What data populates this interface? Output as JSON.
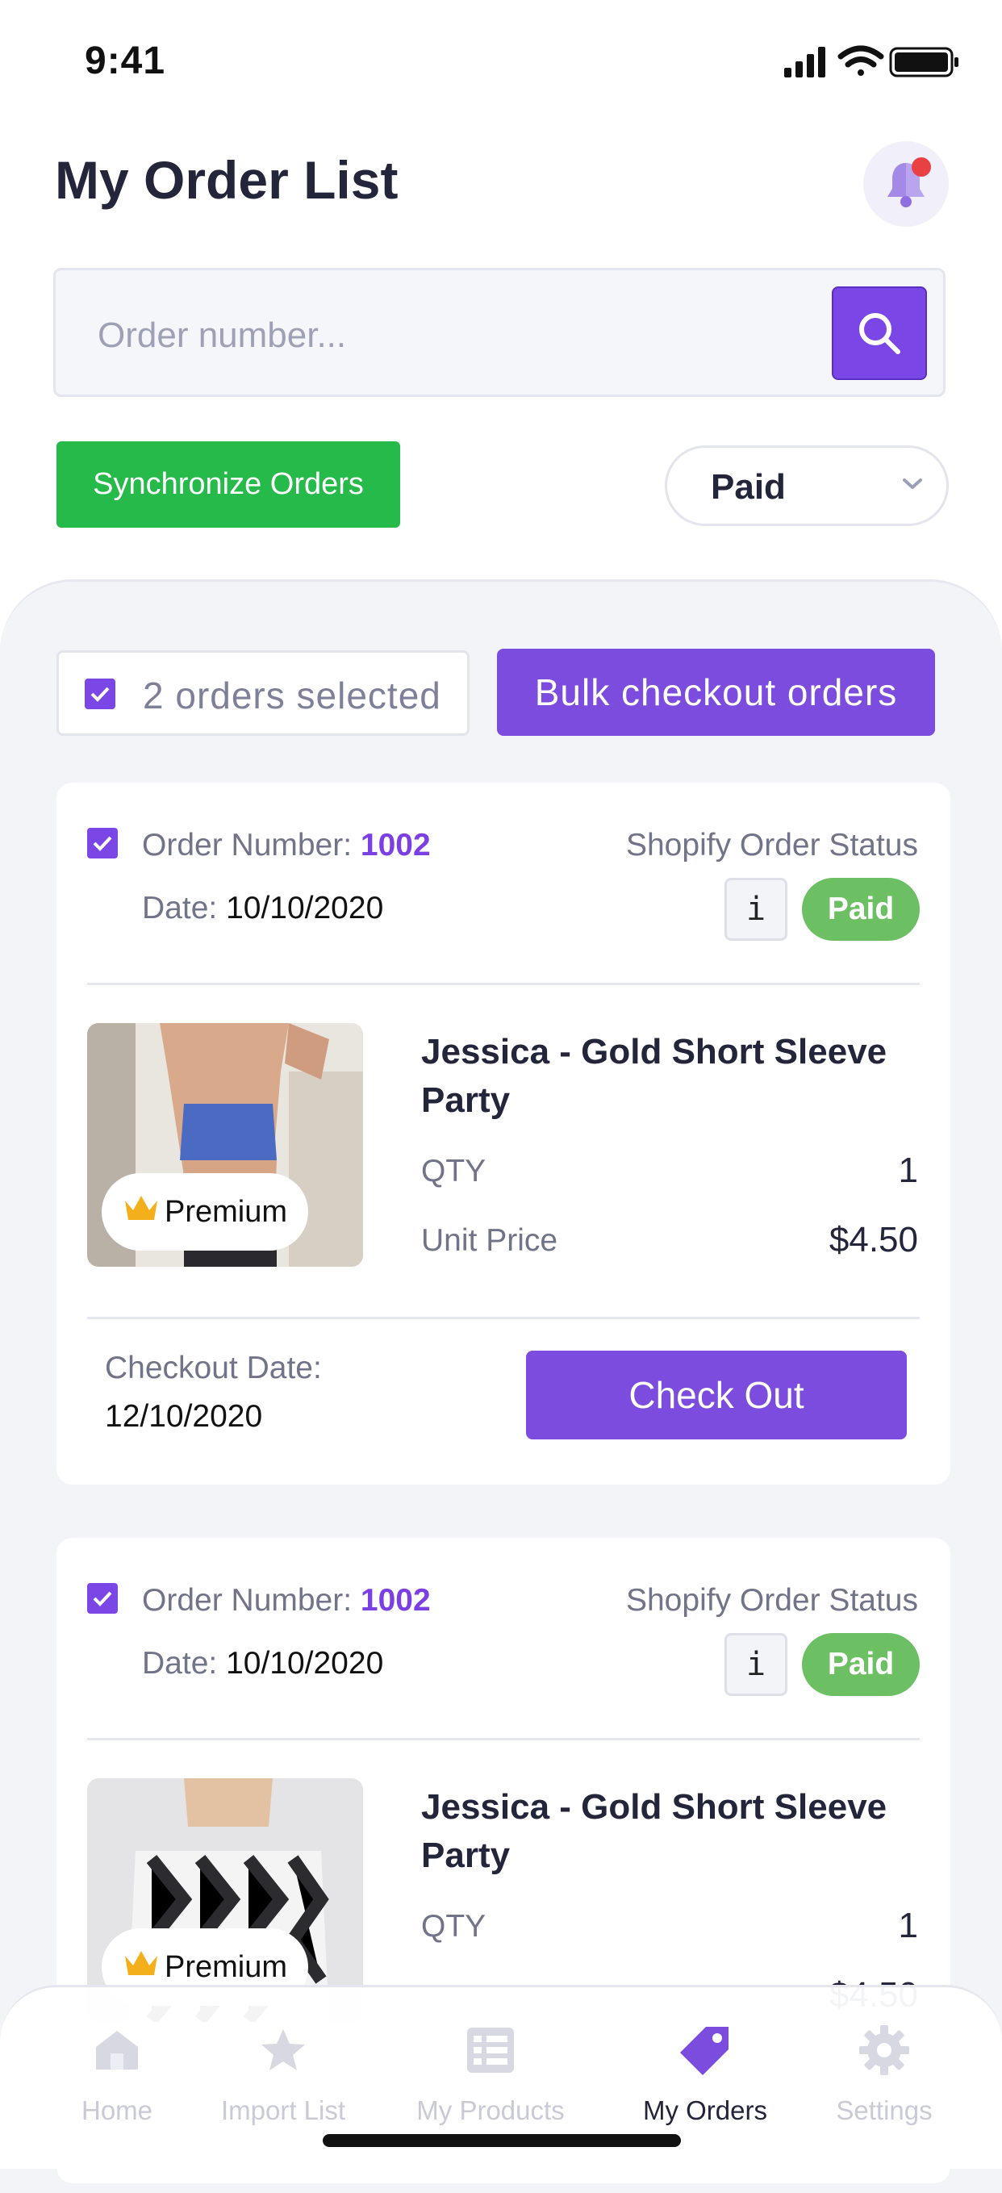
{
  "status_bar": {
    "time": "9:41"
  },
  "header": {
    "title": "My Order List"
  },
  "search": {
    "placeholder": "Order number..."
  },
  "actions": {
    "sync_label": "Synchronize Orders",
    "filter_value": "Paid"
  },
  "bulk": {
    "selected_label": "2 orders selected",
    "bulk_checkout_label": "Bulk checkout orders"
  },
  "orders": [
    {
      "order_label": "Order Number:",
      "order_number": "1002",
      "date_label": "Date:",
      "date": "10/10/2020",
      "status_label": "Shopify Order Status",
      "info_label": "i",
      "status": "Paid",
      "product_name": "Jessica - Gold Short Sleeve Party",
      "qty_label": "QTY",
      "qty": "1",
      "price_label": "Unit Price",
      "price": "$4.50",
      "badge": "Premium",
      "checkout_label": "Checkout Date:",
      "checkout_date": "12/10/2020",
      "checkout_button": "Check Out"
    },
    {
      "order_label": "Order Number:",
      "order_number": "1002",
      "date_label": "Date:",
      "date": "10/10/2020",
      "status_label": "Shopify Order Status",
      "info_label": "i",
      "status": "Paid",
      "product_name": "Jessica - Gold Short Sleeve Party",
      "qty_label": "QTY",
      "qty": "1",
      "price": "$4.50",
      "badge": "Premium"
    }
  ],
  "tabbar": {
    "items": [
      {
        "label": "Home",
        "icon": "home-icon",
        "active": false
      },
      {
        "label": "Import List",
        "icon": "star-icon",
        "active": false
      },
      {
        "label": "My Products",
        "icon": "list-icon",
        "active": false
      },
      {
        "label": "My Orders",
        "icon": "tag-icon",
        "active": true
      },
      {
        "label": "Settings",
        "icon": "gear-icon",
        "active": false
      }
    ]
  },
  "colors": {
    "accent": "#7b4cde",
    "sync_green": "#25ba4a",
    "paid_green": "#6cbf63",
    "notification_red": "#e94044"
  }
}
